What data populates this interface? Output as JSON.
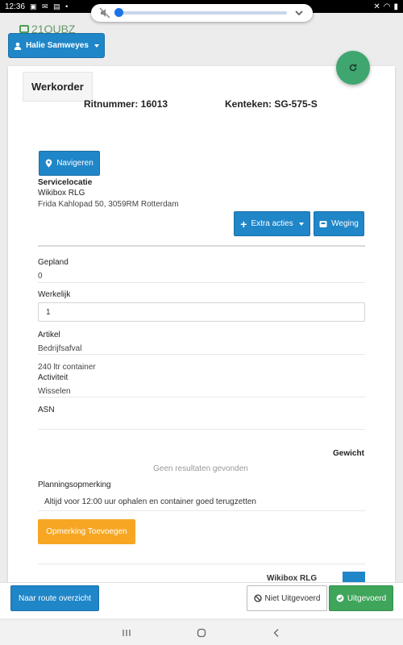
{
  "status_bar": {
    "time": "12:36"
  },
  "header": {
    "logo_text": "21QUBZ",
    "user_name": "Halie Samweyes"
  },
  "card": {
    "title": "Werkorder",
    "ritnummer": "Ritnummer: 16013",
    "kenteken": "Kenteken: SG-575-S"
  },
  "navigate_label": "Navigeren",
  "service": {
    "heading": "Servicelocatie",
    "name": "Wikibox RLG",
    "address": "Frida Kahlopad 50, 3059RM Rotterdam"
  },
  "actions": {
    "extra_label": "Extra acties",
    "weging_label": "Weging"
  },
  "fields": {
    "gepland_label": "Gepland",
    "gepland_value": "0",
    "werkelijk_label": "Werkelijk",
    "werkelijk_value": "1",
    "artikel_label": "Artikel",
    "artikel_value": "Bedrijfsafval",
    "container_value": "240 ltr container",
    "activiteit_label": "Activiteit",
    "activiteit_value": "Wisselen",
    "asn_label": "ASN"
  },
  "weight": {
    "header": "Gewicht",
    "empty": "Geen resultaten gevonden"
  },
  "planning": {
    "label": "Planningsopmerking",
    "note": "Altijd voor 12:00 uur ophalen en container goed terugzetten"
  },
  "add_remark_label": "Opmerking Toevoegen",
  "peek_text": "Wikibox RLG",
  "bottom": {
    "route_label": "Naar route overzicht",
    "not_done_label": "Niet Uitgevoerd",
    "done_label": "Uitgevoerd"
  },
  "colors": {
    "primary": "#1f86c8",
    "success": "#3fa55b",
    "warning": "#f6a623"
  }
}
